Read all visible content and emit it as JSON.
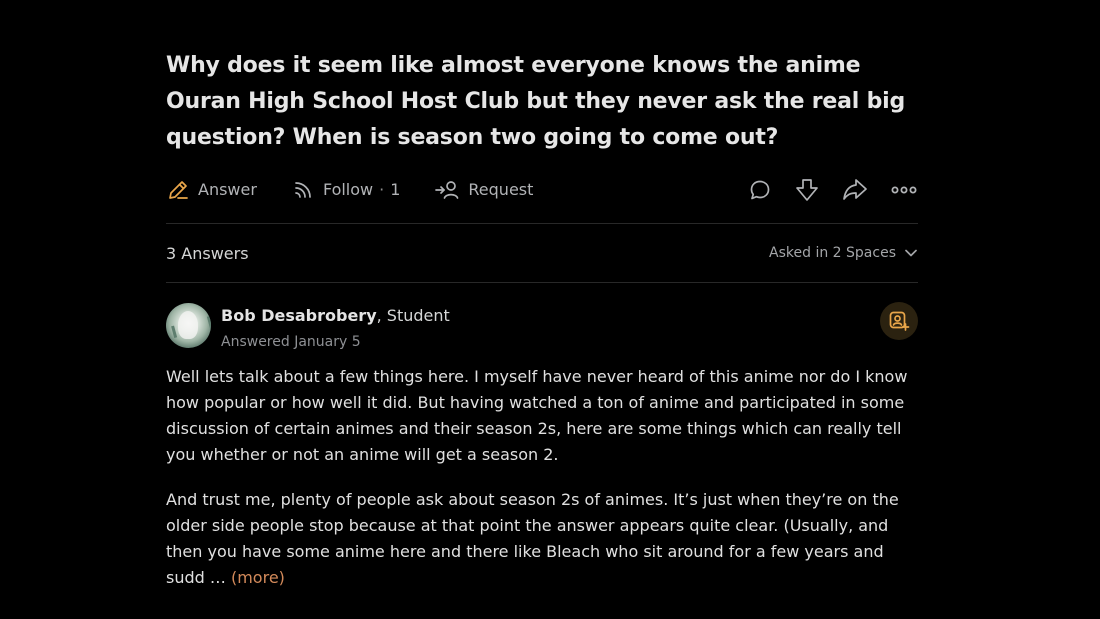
{
  "question": {
    "title": "Why does it seem like almost everyone knows the anime Ouran High School Host Club but they never ask the real big question? When is season two going to come out?"
  },
  "actions": {
    "answer_label": "Answer",
    "follow_label": "Follow",
    "follow_dot": "·",
    "follow_count": "1",
    "request_label": "Request",
    "icons": [
      "pencil-icon",
      "rss-icon",
      "request-user-icon",
      "comment-icon",
      "downvote-icon",
      "share-icon",
      "more-icon"
    ]
  },
  "answers_bar": {
    "count_label": "3 Answers",
    "spaces_label": "Asked in 2 Spaces"
  },
  "answer": {
    "author_name": "Bob Desabrobery",
    "author_separator": ", ",
    "author_credential": "Student",
    "answered_date": "Answered January 5",
    "paragraphs": [
      "Well lets talk about a few things here. I myself have never heard of this anime nor do I know how popular or how well it did. But having watched a ton of anime and participated in some discussion of certain animes and their season 2s, here are some things which can really tell you whether or not an anime will get a season 2.",
      "And trust me, plenty of people ask about season 2s of animes. It’s just when they’re on the older side people stop because at that point the answer appears quite clear. (Usually, and then you have some anime here and there like Bleach who sit around for a few years and sudd … "
    ],
    "more_label": "(more)"
  },
  "colors": {
    "background": "#000000",
    "accent_orange": "#d38a5a",
    "badge_bg": "#2b2210",
    "badge_icon": "#e9a64a",
    "divider": "#282828"
  }
}
